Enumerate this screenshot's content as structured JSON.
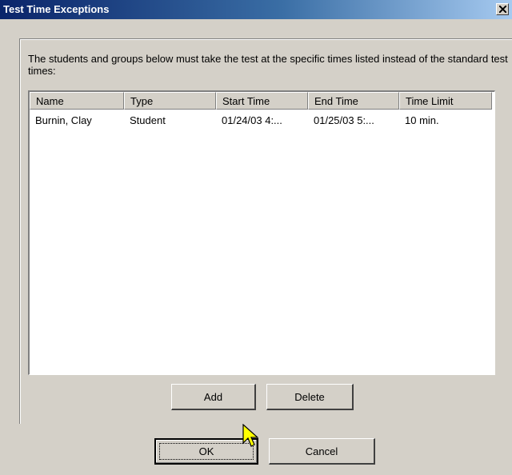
{
  "window": {
    "title": "Test Time Exceptions"
  },
  "description": "The students and groups below must take the test at the specific times listed instead of the standard test times:",
  "list": {
    "columns": [
      "Name",
      "Type",
      "Start Time",
      "End Time",
      "Time Limit"
    ],
    "rows": [
      [
        "Burnin, Clay",
        "Student",
        "01/24/03 4:...",
        "01/25/03 5:...",
        "10 min."
      ]
    ]
  },
  "buttons": {
    "add": "Add",
    "delete": "Delete",
    "ok": "OK",
    "cancel": "Cancel"
  },
  "icons": {
    "close": "close-icon",
    "cursor": "mouse-pointer-icon"
  },
  "colors": {
    "titlebar_start": "#0a246a",
    "titlebar_end": "#a6caf0",
    "dialog_bg": "#d4d0c8",
    "cursor_fill": "#ffff00"
  }
}
